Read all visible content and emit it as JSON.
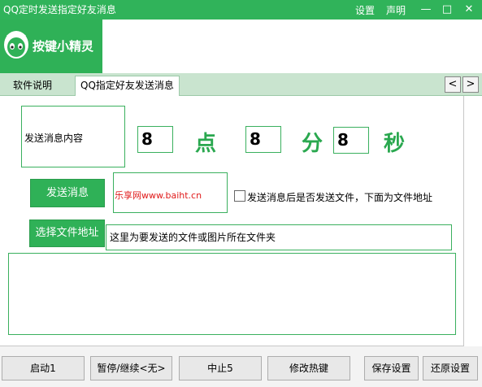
{
  "window": {
    "title": "QQ定时发送指定好友消息",
    "settings_link": "设置",
    "statement_link": "声明",
    "minimize_glyph": "—",
    "maximize_glyph": "□",
    "close_glyph": "✕"
  },
  "brand": {
    "logo_text": "按键小精灵",
    "accent_color": "#30b35a"
  },
  "tabs": [
    {
      "label": "软件说明",
      "active": false
    },
    {
      "label": "QQ指定好友发送消息",
      "active": true
    }
  ],
  "tab_scroll": {
    "left": "<",
    "right": ">"
  },
  "form": {
    "content_label": "发送消息内容",
    "hour_value": "8",
    "hour_unit": "点",
    "minute_value": "8",
    "minute_unit": "分",
    "second_value": "8",
    "second_unit": "秒",
    "send_button": "发送消息",
    "message_text": "乐享网www.baiht.cn",
    "send_file_checkbox_label": "发送消息后是否发送文件，下面为文件地址",
    "send_file_checked": false,
    "choose_file_button": "选择文件地址",
    "file_path_value": "这里为要发送的文件或图片所在文件夹",
    "log_text": ""
  },
  "bottom_buttons": {
    "start": "启动1",
    "pause": "暂停/继续<无>",
    "stop": "中止5",
    "hotkey": "修改热键",
    "save": "保存设置",
    "restore": "还原设置"
  }
}
